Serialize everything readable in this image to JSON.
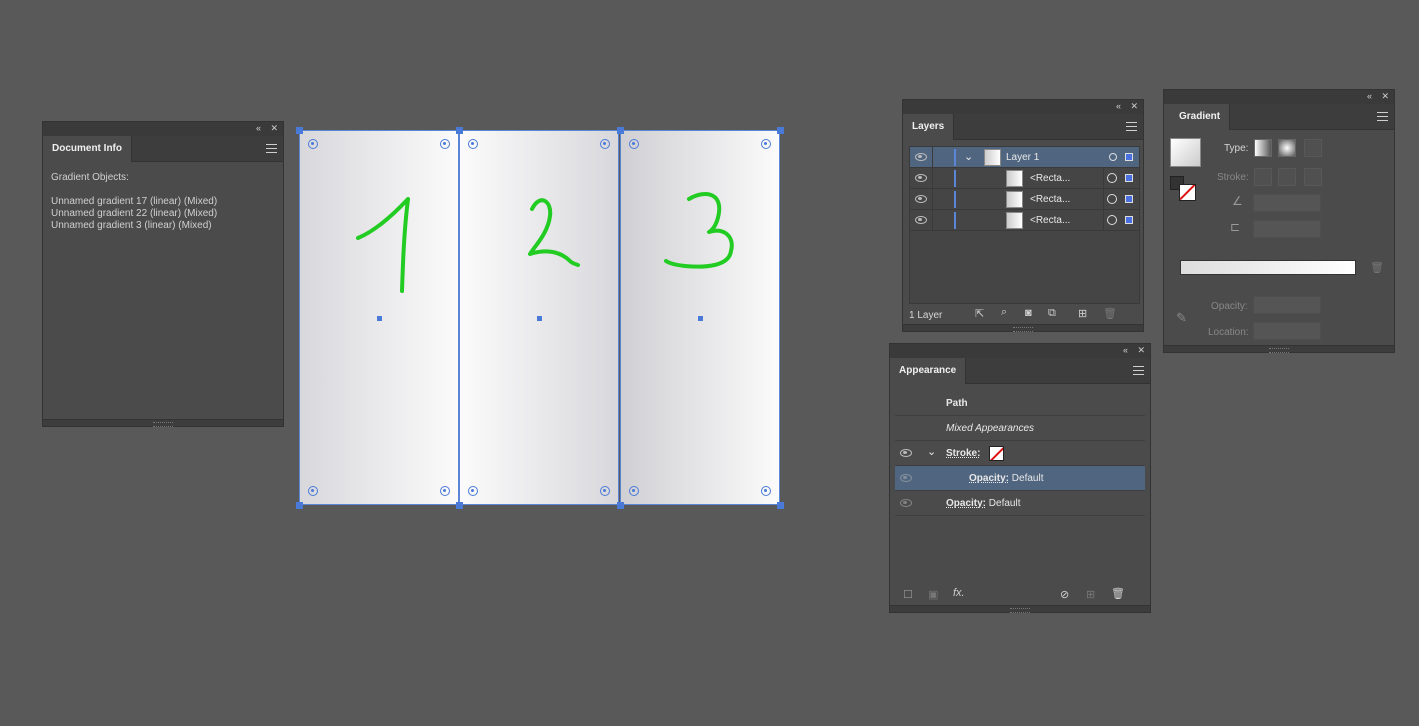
{
  "document_info": {
    "tab": "Document Info",
    "heading": "Gradient Objects:",
    "items": [
      "Unnamed gradient 17 (linear) (Mixed)",
      "Unnamed gradient 22 (linear) (Mixed)",
      "Unnamed gradient 3 (linear) (Mixed)"
    ]
  },
  "canvas": {
    "artboard_labels": [
      "1",
      "2",
      "3"
    ],
    "handwriting_color": "#22cc22",
    "selection_color": "#4a7ad8"
  },
  "layers": {
    "tab": "Layers",
    "rows": [
      {
        "name": "Layer 1"
      },
      {
        "name": "<Recta..."
      },
      {
        "name": "<Recta..."
      },
      {
        "name": "<Recta..."
      }
    ],
    "footer": "1 Layer"
  },
  "appearance": {
    "tab": "Appearance",
    "path_label": "Path",
    "mixed_label": "Mixed Appearances",
    "stroke_label": "Stroke:",
    "opacity_label": "Opacity:",
    "stroke_opacity_value": "Default",
    "opacity_value": "Default",
    "fx_label": "fx."
  },
  "gradient": {
    "tab": "Gradient",
    "type_label": "Type:",
    "stroke_label": "Stroke:",
    "opacity_label": "Opacity:",
    "location_label": "Location:"
  },
  "icons": {
    "collapse": "«",
    "close": "✕",
    "eye": "eye-icon",
    "chevron": "chevron-down-icon"
  }
}
